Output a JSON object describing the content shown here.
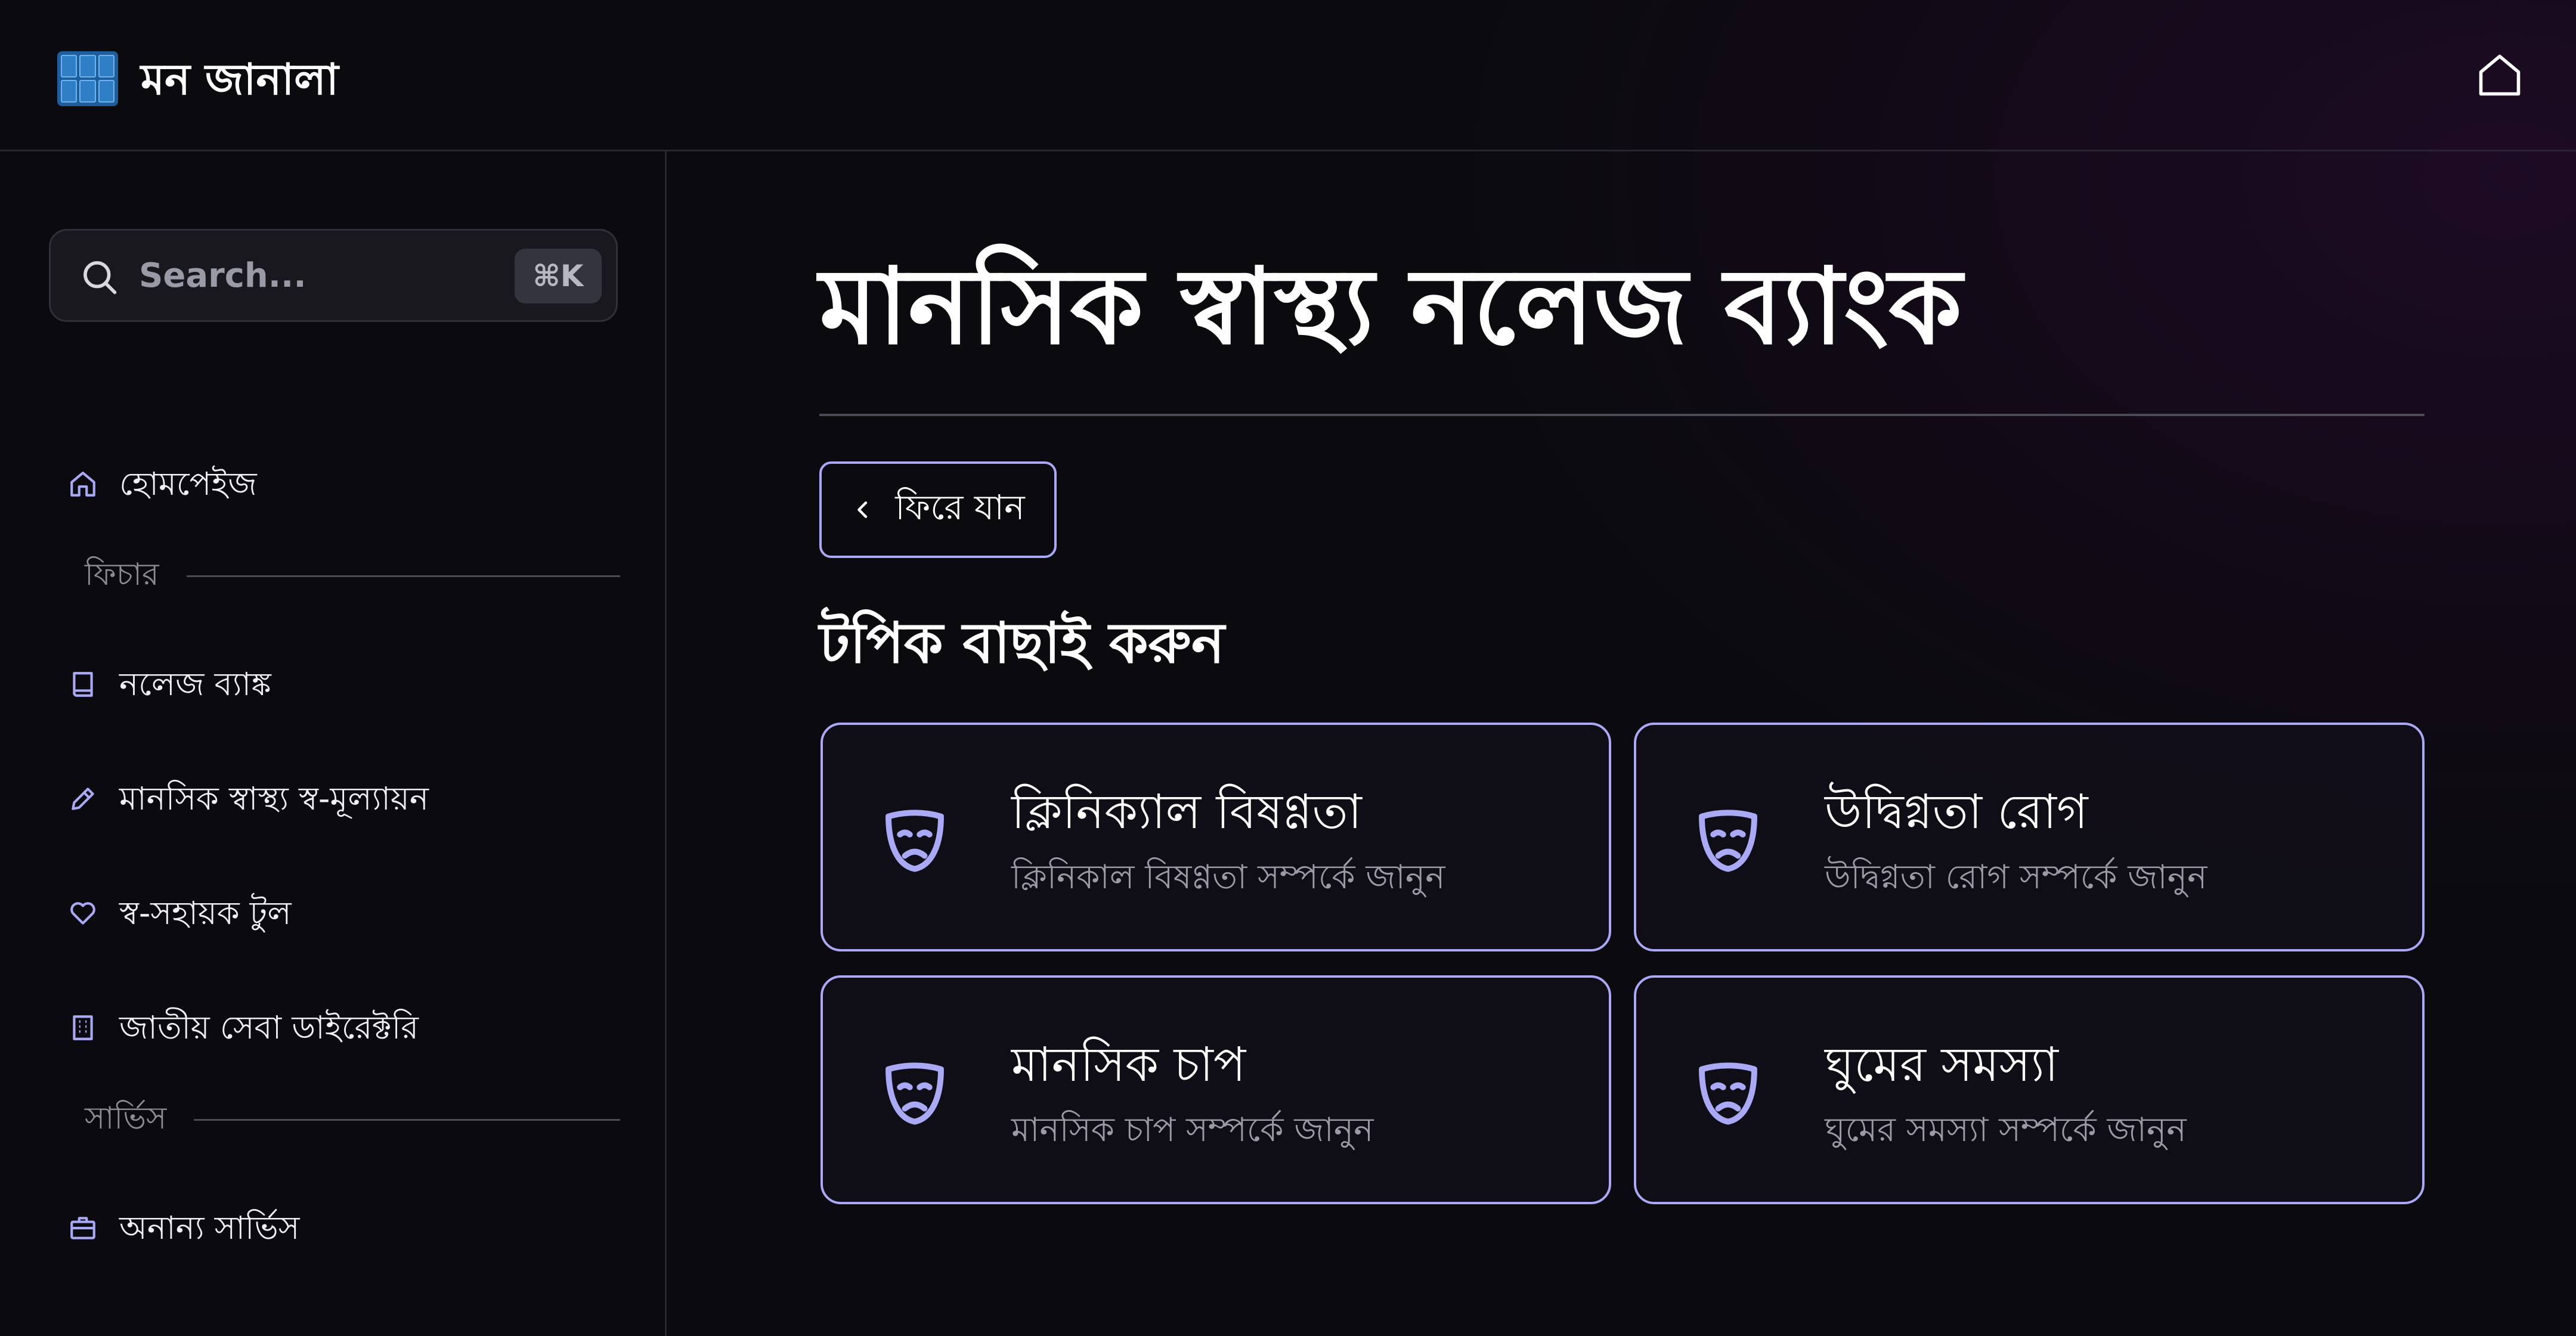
{
  "header": {
    "app_name": "মন জানালা",
    "logo_icon": "app-logo-icon",
    "theme_icon": "moon-icon",
    "home_icon": "home-icon"
  },
  "sidebar": {
    "search": {
      "placeholder": "Search...",
      "shortcut": "⌘K"
    },
    "items": [
      {
        "label": "হোমপেইজ",
        "icon": "home-icon"
      },
      {
        "label": "নলেজ ব্যাঙ্ক",
        "icon": "book-icon"
      },
      {
        "label": "মানসিক স্বাস্থ্য স্ব-মূল্যায়ন",
        "icon": "pencil-icon"
      },
      {
        "label": "স্ব-সহায়ক টুল",
        "icon": "heart-icon"
      },
      {
        "label": "জাতীয় সেবা ডাইরেক্টরি",
        "icon": "building-icon"
      },
      {
        "label": "অনান্য সার্ভিস",
        "icon": "briefcase-icon"
      }
    ],
    "sections": [
      {
        "label": "ফিচার"
      },
      {
        "label": "সার্ভিস"
      }
    ]
  },
  "main": {
    "title": "মানসিক স্বাস্থ্য নলেজ ব্যাংক",
    "back_label": "ফিরে যান",
    "topics_heading": "টপিক বাছাই করুন",
    "topics": [
      {
        "title": "ক্লিনিক্যাল বিষণ্ণতা",
        "description": "ক্লিনিকাল বিষণ্ণতা সম্পর্কে জানুন",
        "icon": "sad-mask-icon"
      },
      {
        "title": "উদ্বিগ্নতা রোগ",
        "description": "উদ্বিগ্নতা রোগ সম্পর্কে জানুন",
        "icon": "sad-mask-icon"
      },
      {
        "title": "মানসিক চাপ",
        "description": "মানসিক চাপ সম্পর্কে জানুন",
        "icon": "sad-mask-icon"
      },
      {
        "title": "ঘুমের সমস্যা",
        "description": "ঘুমের সমস্যা সম্পর্কে জানুন",
        "icon": "sad-mask-icon"
      }
    ]
  },
  "colors": {
    "accent_border": "#a9a9f5",
    "icon_color": "#a9a9f5",
    "background": "#0b0b0f"
  }
}
